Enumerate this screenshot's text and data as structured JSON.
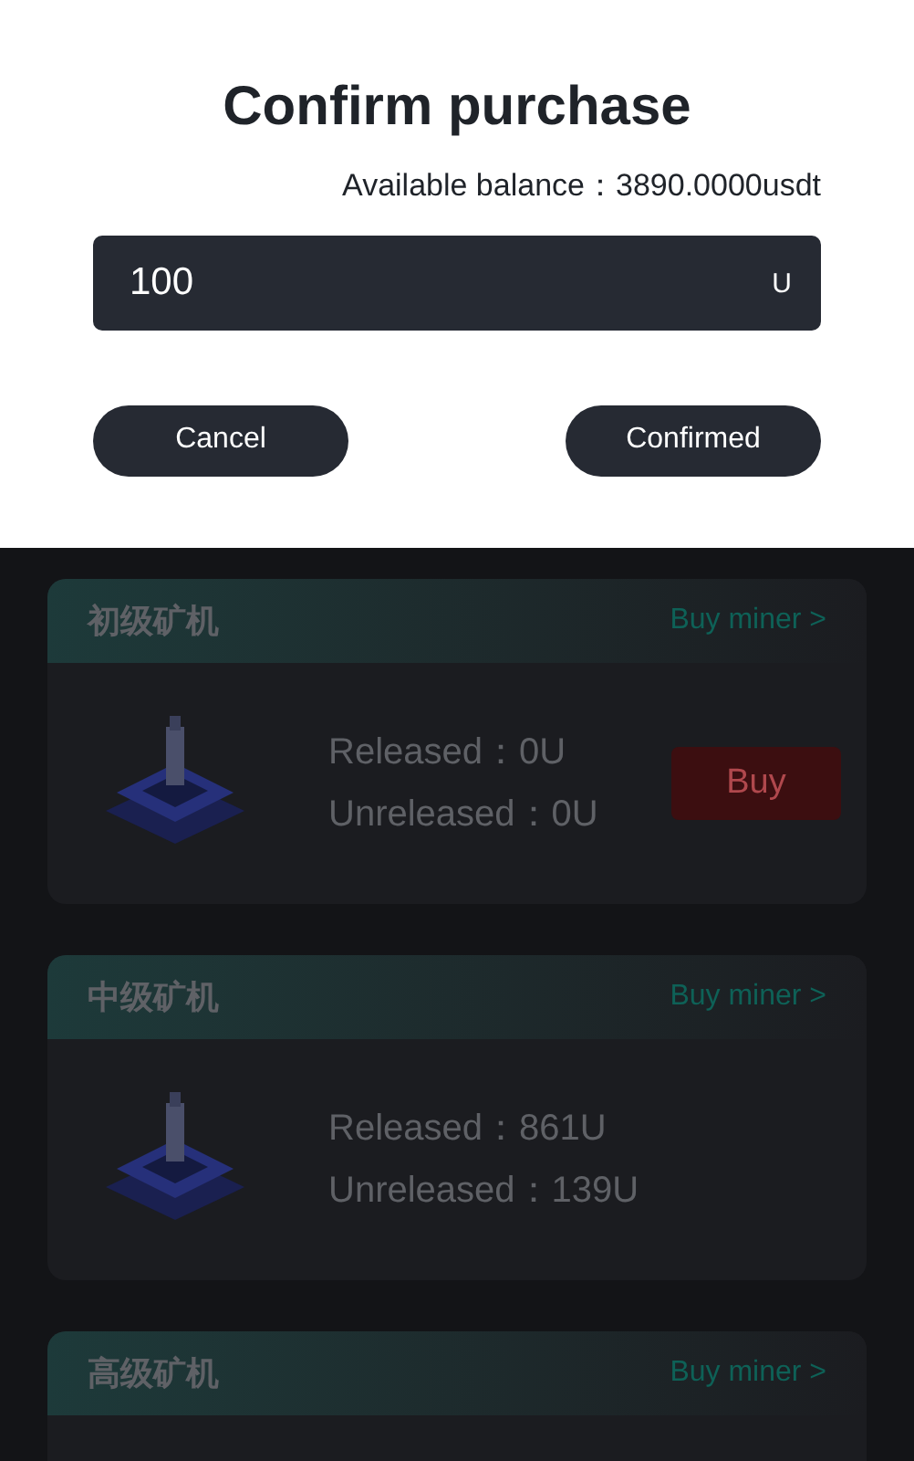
{
  "dialog": {
    "title": "Confirm purchase",
    "balance_label": "Available balance：",
    "balance_value": "3890.0000usdt",
    "amount_input": {
      "value": "100",
      "unit": "U"
    },
    "buttons": [
      "Cancel",
      "Confirmed"
    ]
  },
  "miners": [
    {
      "name": "初级矿机",
      "link": "Buy miner >",
      "released": "Released：0U",
      "unreleased": "Unreleased：0U",
      "buy_button": "Buy"
    },
    {
      "name": "中级矿机",
      "link": "Buy miner >",
      "released": "Released：861U",
      "unreleased": "Unreleased：139U"
    },
    {
      "name": "高级矿机",
      "link": "Buy miner >"
    }
  ]
}
